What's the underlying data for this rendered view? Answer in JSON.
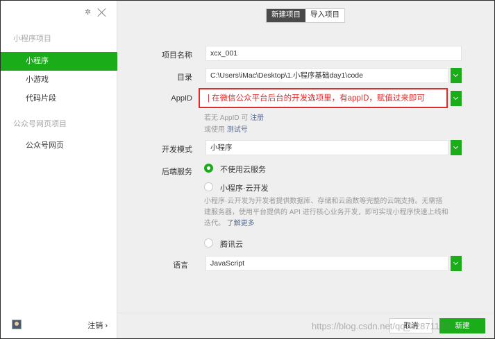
{
  "sidebar": {
    "section_miniprogram": "小程序项目",
    "items_mp": [
      {
        "label": "小程序"
      },
      {
        "label": "小游戏"
      },
      {
        "label": "代码片段"
      }
    ],
    "section_web": "公众号网页项目",
    "items_web": [
      {
        "label": "公众号网页"
      }
    ],
    "logout_label": "注销 ›"
  },
  "tabs": [
    {
      "label": "新建项目"
    },
    {
      "label": "导入项目"
    }
  ],
  "form": {
    "project_name_label": "项目名称",
    "project_name_value": "xcx_001",
    "dir_label": "目录",
    "dir_value": "C:\\Users\\iMac\\Desktop\\1.小程序基础day1\\code",
    "appid_label": "AppID",
    "appid_annotation": "|    在微信公众平台后台的开发选项里，有appID，赋值过来即可",
    "hint_no_appid": "若无 AppID 可",
    "hint_register": "注册",
    "hint_or_use": "或使用",
    "hint_test": "测试号",
    "dev_mode_label": "开发模式",
    "dev_mode_value": "小程序",
    "backend_label": "后端服务",
    "backend_options": [
      {
        "label": "不使用云服务",
        "checked": true
      },
      {
        "label": "小程序·云开发",
        "checked": false
      },
      {
        "label": "腾讯云",
        "checked": false
      }
    ],
    "cloud_desc_1": "小程序·云开发为开发者提供数据库、存储和云函数等完整的云端支持。无需搭",
    "cloud_desc_2": "建服务器，使用平台提供的 API 进行核心业务开发，即可实现小程序快速上线和",
    "cloud_desc_3": "迭代。",
    "learn_more": "了解更多",
    "language_label": "语言",
    "language_value": "JavaScript"
  },
  "footer": {
    "cancel_label": "取消",
    "create_label": "新建",
    "watermark": "https://blog.csdn.net/qq_42871170"
  },
  "colors": {
    "accent": "#1aad19",
    "annotation": "#e02b2b",
    "link": "#576b95"
  }
}
